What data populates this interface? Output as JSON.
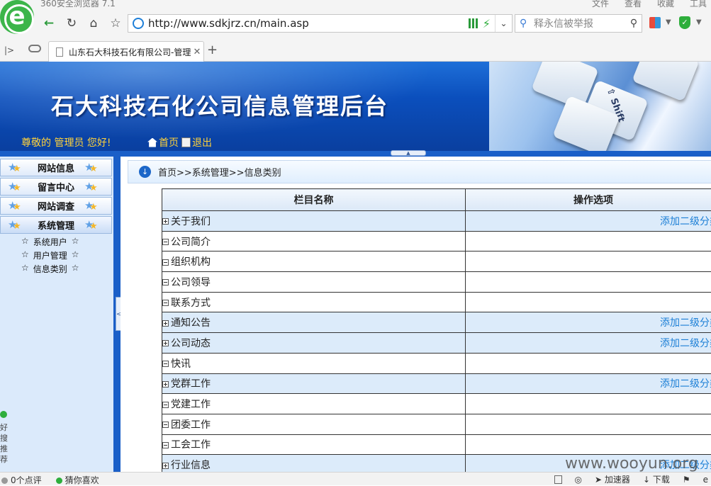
{
  "browser": {
    "app_title": "360安全浏览器 7.1",
    "menu": [
      "文件",
      "查看",
      "收藏",
      "工具"
    ],
    "url": "http://www.sdkjrz.cn/main.asp",
    "search_placeholder": "释永信被举报",
    "tab_title": "山东石大科技石化有限公司-管理",
    "icons": {
      "back": "arrow-left-icon",
      "reload": "reload-icon",
      "home": "home-icon",
      "star": "star-icon",
      "lens": "search-icon"
    }
  },
  "site": {
    "title": "石大科技石化公司信息管理后台",
    "greeting": "尊敬的 管理员 您好!",
    "home_link": "首页",
    "exit_link": "退出"
  },
  "leftnav": {
    "groups": [
      "网站信息",
      "留言中心",
      "网站调查",
      "系统管理"
    ],
    "sub_items": [
      "系统用户",
      "用户管理",
      "信息类别"
    ],
    "side_widget": "好搜推荐"
  },
  "content": {
    "breadcrumb": "首页>>系统管理>>信息类别",
    "columns": [
      "栏目名称",
      "操作选项"
    ],
    "rows": [
      {
        "name": "关于我们",
        "op": "添加二级分类"
      },
      {
        "name": "公司简介",
        "op": ""
      },
      {
        "name": "组织机构",
        "op": ""
      },
      {
        "name": "公司领导",
        "op": ""
      },
      {
        "name": "联系方式",
        "op": ""
      },
      {
        "name": "通知公告",
        "op": "添加二级分类"
      },
      {
        "name": "公司动态",
        "op": "添加二级分类"
      },
      {
        "name": "快讯",
        "op": ""
      },
      {
        "name": "党群工作",
        "op": "添加二级分类"
      },
      {
        "name": "党建工作",
        "op": ""
      },
      {
        "name": "团委工作",
        "op": ""
      },
      {
        "name": "工会工作",
        "op": ""
      },
      {
        "name": "行业信息",
        "op": "添加二级分类"
      }
    ]
  },
  "watermark": "www.wooyun.org",
  "statusbar": {
    "left": [
      "0个点评",
      "猜你喜欢"
    ],
    "right": [
      "加速器",
      "下载"
    ]
  },
  "colors": {
    "banner": "#0b4fbd",
    "accent_link": "#1c7fd6",
    "greeting": "#ffd23a",
    "parent_row": "#dcebfa"
  }
}
